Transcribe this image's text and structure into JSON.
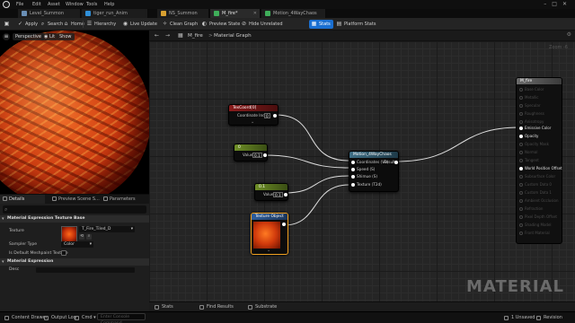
{
  "menu": [
    "File",
    "Edit",
    "Asset",
    "Window",
    "Tools",
    "Help"
  ],
  "tabs": [
    {
      "label": "Level_Summon",
      "active": false
    },
    {
      "label": "tiger_run_Anim",
      "active": false
    },
    {
      "label": "NS_Summon",
      "active": false
    },
    {
      "label": "M_fire*",
      "active": true
    },
    {
      "label": "Motion_4WayChaos",
      "active": false
    }
  ],
  "toolbar": {
    "save": "",
    "apply": "Apply",
    "search": "Search",
    "home": "Home",
    "hierarchy": "Hierarchy",
    "live_update": "Live Update",
    "clean_graph": "Clean Graph",
    "preview_state": "Preview State",
    "hide_unrelated": "Hide Unrelated",
    "stats": "Stats",
    "platform_stats": "Platform Stats"
  },
  "viewport": {
    "perspective": "Perspective",
    "lit": "Lit",
    "show": "Show"
  },
  "details": {
    "tabs": [
      "Details",
      "Preview Scene S...",
      "Parameters"
    ],
    "sections": {
      "texture_base": "Material Expression Texture Base",
      "expression": "Material Expression"
    },
    "props": {
      "texture_label": "Texture",
      "texture_value": "T_Fire_Tiled_D",
      "sampler_label": "Sampler Type",
      "sampler_value": "Color",
      "default_mesh_label": "Is Default Meshpaint Texture",
      "desc_label": "Desc"
    }
  },
  "graph": {
    "back": "←",
    "forward": "→",
    "breadcrumb_root": "M_fire",
    "breadcrumb_sep": ">",
    "breadcrumb_leaf": "Material Graph",
    "zoom": "Zoom -6",
    "watermark": "MATERIAL"
  },
  "nodes": {
    "texcoord": {
      "title": "TexCoord[0]",
      "pin": "Coordinate Index",
      "value": "0"
    },
    "const1": {
      "title": "0",
      "pin": "Value",
      "value": "0.1"
    },
    "const2": {
      "title": "0.1",
      "pin": "Value",
      "value": "0.1"
    },
    "texobj": {
      "title": "Texture Object"
    },
    "motion": {
      "title": "Motion_4WayChaos",
      "inputs": [
        "Coordinates (V2)",
        "Speed (S)",
        "Shimue (S)",
        "Texture (T2d)"
      ],
      "output": "Result"
    },
    "result": {
      "title": "M_fire",
      "pins": [
        {
          "label": "Base Color",
          "on": false
        },
        {
          "label": "Metallic",
          "on": false
        },
        {
          "label": "Specular",
          "on": false
        },
        {
          "label": "Roughness",
          "on": false
        },
        {
          "label": "Anisotropy",
          "on": false
        },
        {
          "label": "Emissive Color",
          "on": true
        },
        {
          "label": "Opacity",
          "on": true
        },
        {
          "label": "Opacity Mask",
          "on": false
        },
        {
          "label": "Normal",
          "on": false
        },
        {
          "label": "Tangent",
          "on": false
        },
        {
          "label": "World Position Offset",
          "on": true
        },
        {
          "label": "Subsurface Color",
          "on": false
        },
        {
          "label": "Custom Data 0",
          "on": false
        },
        {
          "label": "Custom Data 1",
          "on": false
        },
        {
          "label": "Ambient Occlusion",
          "on": false
        },
        {
          "label": "Refraction",
          "on": false
        },
        {
          "label": "Pixel Depth Offset",
          "on": false
        },
        {
          "label": "Shading Model",
          "on": false
        },
        {
          "label": "Front Material",
          "on": false
        }
      ]
    }
  },
  "bottom_tabs": [
    "Stats",
    "Find Results",
    "Substrate"
  ],
  "status": {
    "content_drawer": "Content Drawer",
    "output_log": "Output Log",
    "cmd": "Cmd",
    "cmd_placeholder": "Enter Console Command",
    "unsaved": "1 Unsaved",
    "revision_control": "Revision Control"
  },
  "colors": {
    "accent_blue": "#1a6fd1",
    "texcoord_header": "#8a1c1c",
    "constant_header": "#6f8f27",
    "texobj_header": "#2f5f9e",
    "motion_header": "#3f6f86",
    "selection_orange": "#f0a020"
  }
}
